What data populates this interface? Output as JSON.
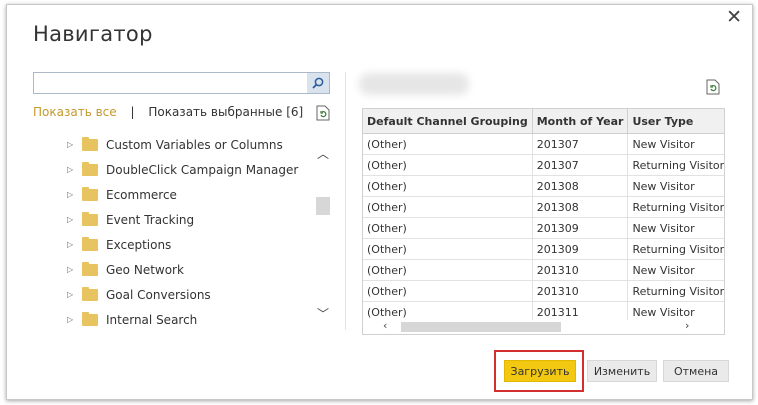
{
  "dialog": {
    "title": "Навигатор"
  },
  "search": {
    "placeholder": ""
  },
  "links": {
    "show_all": "Показать все",
    "separator": "|",
    "show_selected": "Показать выбранные [6]"
  },
  "tree": {
    "items": [
      "Custom Variables or Columns",
      "DoubleClick Campaign Manager",
      "Ecommerce",
      "Event Tracking",
      "Exceptions",
      "Geo Network",
      "Goal Conversions",
      "Internal Search"
    ]
  },
  "preview": {
    "columns": [
      "Default Channel Grouping",
      "Month of Year",
      "User Type"
    ],
    "rows": [
      [
        "(Other)",
        "201307",
        "New Visitor"
      ],
      [
        "(Other)",
        "201307",
        "Returning Visitor"
      ],
      [
        "(Other)",
        "201308",
        "New Visitor"
      ],
      [
        "(Other)",
        "201308",
        "Returning Visitor"
      ],
      [
        "(Other)",
        "201309",
        "New Visitor"
      ],
      [
        "(Other)",
        "201309",
        "Returning Visitor"
      ],
      [
        "(Other)",
        "201310",
        "New Visitor"
      ],
      [
        "(Other)",
        "201310",
        "Returning Visitor"
      ],
      [
        "(Other)",
        "201311",
        "New Visitor"
      ]
    ]
  },
  "buttons": {
    "load": "Загрузить",
    "edit": "Изменить",
    "cancel": "Отмена"
  },
  "colors": {
    "accent": "#f2c811",
    "link": "#c4982c",
    "highlight_frame": "#d32f2f",
    "folder": "#e8c460"
  }
}
